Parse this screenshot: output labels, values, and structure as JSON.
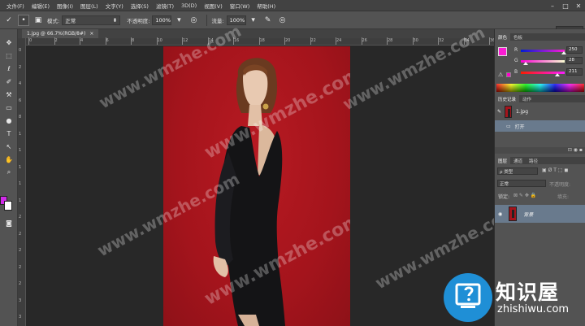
{
  "menu": [
    "文件(F)",
    "编辑(E)",
    "图像(I)",
    "图层(L)",
    "文字(Y)",
    "选择(S)",
    "滤镜(T)",
    "3D(D)",
    "视图(V)",
    "窗口(W)",
    "帮助(H)"
  ],
  "options": {
    "mode_label": "模式:",
    "mode_value": "正常",
    "opacity_label": "不透明度:",
    "opacity_value": "100%",
    "flow_label": "流量:",
    "flow_value": "100%",
    "workspace": "基本功能"
  },
  "document": {
    "tab_title": "1.jpg @ 66.7%(RGB/8#)",
    "ruler_numbers": [
      "0",
      "2",
      "4",
      "6",
      "8",
      "10",
      "12",
      "14",
      "16",
      "18",
      "20",
      "22",
      "24",
      "26",
      "28",
      "30",
      "32",
      "34",
      "36"
    ],
    "ruler_v_numbers": [
      "0",
      "2",
      "4",
      "6",
      "8",
      "1",
      "1",
      "1",
      "1",
      "1",
      "2",
      "2",
      "2",
      "2",
      "2",
      "3",
      "3"
    ]
  },
  "watermark": "www.wmzhe.com",
  "color_panel": {
    "tabs": [
      "颜色",
      "色板"
    ],
    "channels": [
      {
        "label": "R",
        "value": "250",
        "level": 0.98
      },
      {
        "label": "G",
        "value": "28",
        "level": 0.11
      },
      {
        "label": "B",
        "value": "211",
        "level": 0.83
      }
    ],
    "fg_color": "#fa1cd3"
  },
  "history_panel": {
    "tabs": [
      "历史记录",
      "动作"
    ],
    "snapshot": "1.jpg",
    "step": "打开"
  },
  "layers_panel": {
    "tabs": [
      "图层",
      "通道",
      "路径"
    ],
    "filter": "ρ 类型",
    "blend": "正常",
    "opacity_label": "不透明度:",
    "lock_label": "锁定:",
    "fill_label": "填充:",
    "layer_name": "背景"
  },
  "logo": {
    "name": "知识屋",
    "url": "zhishiwu.com",
    "badge_color": "#1f8fd6"
  }
}
